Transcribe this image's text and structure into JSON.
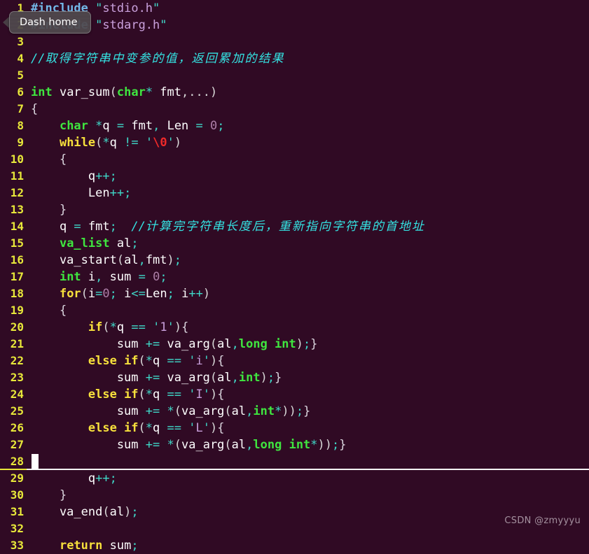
{
  "editor": {
    "background_color": "#300a24",
    "line_number_color": "#e8e83a",
    "current_line": 28,
    "cursor_line": 28,
    "lines": [
      {
        "n": "1",
        "tokens": [
          {
            "c": "t-pre",
            "t": "#include"
          },
          {
            "c": "t-plain",
            "t": " "
          },
          {
            "c": "t-quote",
            "t": "\""
          },
          {
            "c": "t-str",
            "t": "stdio.h"
          },
          {
            "c": "t-quote",
            "t": "\""
          }
        ]
      },
      {
        "n": "2",
        "tokens": [
          {
            "c": "t-pre",
            "t": "#include"
          },
          {
            "c": "t-plain",
            "t": " "
          },
          {
            "c": "t-quote",
            "t": "\""
          },
          {
            "c": "t-str",
            "t": "stdarg.h"
          },
          {
            "c": "t-quote",
            "t": "\""
          }
        ]
      },
      {
        "n": "3",
        "tokens": []
      },
      {
        "n": "4",
        "tokens": [
          {
            "c": "t-comment",
            "t": "//"
          },
          {
            "c": "t-comment t-cjk",
            "t": "取得字符串中变参的值，返回累加的结果"
          }
        ]
      },
      {
        "n": "5",
        "tokens": []
      },
      {
        "n": "6",
        "tokens": [
          {
            "c": "t-type",
            "t": "int"
          },
          {
            "c": "t-plain",
            "t": " var_sum"
          },
          {
            "c": "t-punc",
            "t": "("
          },
          {
            "c": "t-type",
            "t": "char"
          },
          {
            "c": "t-op",
            "t": "*"
          },
          {
            "c": "t-plain",
            "t": " fmt"
          },
          {
            "c": "t-punc",
            "t": ",...)"
          }
        ]
      },
      {
        "n": "7",
        "tokens": [
          {
            "c": "t-brace",
            "t": "{"
          }
        ]
      },
      {
        "n": "8",
        "tokens": [
          {
            "c": "t-plain",
            "t": "    "
          },
          {
            "c": "t-type",
            "t": "char"
          },
          {
            "c": "t-plain",
            "t": " "
          },
          {
            "c": "t-op",
            "t": "*"
          },
          {
            "c": "t-plain",
            "t": "q "
          },
          {
            "c": "t-op",
            "t": "="
          },
          {
            "c": "t-plain",
            "t": " fmt"
          },
          {
            "c": "t-op",
            "t": ","
          },
          {
            "c": "t-plain",
            "t": " Len "
          },
          {
            "c": "t-op",
            "t": "="
          },
          {
            "c": "t-plain",
            "t": " "
          },
          {
            "c": "t-num",
            "t": "0"
          },
          {
            "c": "t-op",
            "t": ";"
          }
        ]
      },
      {
        "n": "9",
        "tokens": [
          {
            "c": "t-plain",
            "t": "    "
          },
          {
            "c": "t-key",
            "t": "while"
          },
          {
            "c": "t-punc",
            "t": "("
          },
          {
            "c": "t-op",
            "t": "*"
          },
          {
            "c": "t-plain",
            "t": "q "
          },
          {
            "c": "t-op",
            "t": "!="
          },
          {
            "c": "t-plain",
            "t": " "
          },
          {
            "c": "t-quote",
            "t": "'"
          },
          {
            "c": "t-esc",
            "t": "\\0"
          },
          {
            "c": "t-quote",
            "t": "'"
          },
          {
            "c": "t-punc",
            "t": ")"
          }
        ]
      },
      {
        "n": "10",
        "tokens": [
          {
            "c": "t-plain",
            "t": "    "
          },
          {
            "c": "t-brace",
            "t": "{"
          }
        ]
      },
      {
        "n": "11",
        "tokens": [
          {
            "c": "t-plain",
            "t": "        q"
          },
          {
            "c": "t-op",
            "t": "++;"
          }
        ]
      },
      {
        "n": "12",
        "tokens": [
          {
            "c": "t-plain",
            "t": "        Len"
          },
          {
            "c": "t-op",
            "t": "++;"
          }
        ]
      },
      {
        "n": "13",
        "tokens": [
          {
            "c": "t-plain",
            "t": "    "
          },
          {
            "c": "t-brace",
            "t": "}"
          }
        ]
      },
      {
        "n": "14",
        "tokens": [
          {
            "c": "t-plain",
            "t": "    q "
          },
          {
            "c": "t-op",
            "t": "="
          },
          {
            "c": "t-plain",
            "t": " fmt"
          },
          {
            "c": "t-op",
            "t": ";"
          },
          {
            "c": "t-plain",
            "t": "  "
          },
          {
            "c": "t-comment",
            "t": "//"
          },
          {
            "c": "t-comment t-cjk",
            "t": "计算完字符串长度后，重新指向字符串的首地址"
          }
        ]
      },
      {
        "n": "15",
        "tokens": [
          {
            "c": "t-plain",
            "t": "    "
          },
          {
            "c": "t-type",
            "t": "va_list"
          },
          {
            "c": "t-plain",
            "t": " al"
          },
          {
            "c": "t-op",
            "t": ";"
          }
        ]
      },
      {
        "n": "16",
        "tokens": [
          {
            "c": "t-plain",
            "t": "    va_start"
          },
          {
            "c": "t-punc",
            "t": "("
          },
          {
            "c": "t-plain",
            "t": "al"
          },
          {
            "c": "t-op",
            "t": ","
          },
          {
            "c": "t-plain",
            "t": "fmt"
          },
          {
            "c": "t-punc",
            "t": ")"
          },
          {
            "c": "t-op",
            "t": ";"
          }
        ]
      },
      {
        "n": "17",
        "tokens": [
          {
            "c": "t-plain",
            "t": "    "
          },
          {
            "c": "t-type",
            "t": "int"
          },
          {
            "c": "t-plain",
            "t": " i"
          },
          {
            "c": "t-op",
            "t": ","
          },
          {
            "c": "t-plain",
            "t": " sum "
          },
          {
            "c": "t-op",
            "t": "="
          },
          {
            "c": "t-plain",
            "t": " "
          },
          {
            "c": "t-num",
            "t": "0"
          },
          {
            "c": "t-op",
            "t": ";"
          }
        ]
      },
      {
        "n": "18",
        "tokens": [
          {
            "c": "t-plain",
            "t": "    "
          },
          {
            "c": "t-key",
            "t": "for"
          },
          {
            "c": "t-punc",
            "t": "("
          },
          {
            "c": "t-plain",
            "t": "i"
          },
          {
            "c": "t-op",
            "t": "="
          },
          {
            "c": "t-num",
            "t": "0"
          },
          {
            "c": "t-op",
            "t": ";"
          },
          {
            "c": "t-plain",
            "t": " i"
          },
          {
            "c": "t-op",
            "t": "<="
          },
          {
            "c": "t-plain",
            "t": "Len"
          },
          {
            "c": "t-op",
            "t": ";"
          },
          {
            "c": "t-plain",
            "t": " i"
          },
          {
            "c": "t-op",
            "t": "++"
          },
          {
            "c": "t-punc",
            "t": ")"
          }
        ]
      },
      {
        "n": "19",
        "tokens": [
          {
            "c": "t-plain",
            "t": "    "
          },
          {
            "c": "t-brace",
            "t": "{"
          }
        ]
      },
      {
        "n": "20",
        "tokens": [
          {
            "c": "t-plain",
            "t": "        "
          },
          {
            "c": "t-key",
            "t": "if"
          },
          {
            "c": "t-punc",
            "t": "("
          },
          {
            "c": "t-op",
            "t": "*"
          },
          {
            "c": "t-plain",
            "t": "q "
          },
          {
            "c": "t-op",
            "t": "=="
          },
          {
            "c": "t-plain",
            "t": " "
          },
          {
            "c": "t-quote",
            "t": "'"
          },
          {
            "c": "t-char",
            "t": "1"
          },
          {
            "c": "t-quote",
            "t": "'"
          },
          {
            "c": "t-punc",
            "t": ")"
          },
          {
            "c": "t-brace",
            "t": "{"
          }
        ]
      },
      {
        "n": "21",
        "tokens": [
          {
            "c": "t-plain",
            "t": "            sum "
          },
          {
            "c": "t-op",
            "t": "+="
          },
          {
            "c": "t-plain",
            "t": " va_arg"
          },
          {
            "c": "t-punc",
            "t": "("
          },
          {
            "c": "t-plain",
            "t": "al"
          },
          {
            "c": "t-op",
            "t": ","
          },
          {
            "c": "t-type",
            "t": "long int"
          },
          {
            "c": "t-punc",
            "t": ")"
          },
          {
            "c": "t-op",
            "t": ";"
          },
          {
            "c": "t-brace",
            "t": "}"
          }
        ]
      },
      {
        "n": "22",
        "tokens": [
          {
            "c": "t-plain",
            "t": "        "
          },
          {
            "c": "t-key",
            "t": "else if"
          },
          {
            "c": "t-punc",
            "t": "("
          },
          {
            "c": "t-op",
            "t": "*"
          },
          {
            "c": "t-plain",
            "t": "q "
          },
          {
            "c": "t-op",
            "t": "=="
          },
          {
            "c": "t-plain",
            "t": " "
          },
          {
            "c": "t-quote",
            "t": "'"
          },
          {
            "c": "t-char",
            "t": "i"
          },
          {
            "c": "t-quote",
            "t": "'"
          },
          {
            "c": "t-punc",
            "t": ")"
          },
          {
            "c": "t-brace",
            "t": "{"
          }
        ]
      },
      {
        "n": "23",
        "tokens": [
          {
            "c": "t-plain",
            "t": "            sum "
          },
          {
            "c": "t-op",
            "t": "+="
          },
          {
            "c": "t-plain",
            "t": " va_arg"
          },
          {
            "c": "t-punc",
            "t": "("
          },
          {
            "c": "t-plain",
            "t": "al"
          },
          {
            "c": "t-op",
            "t": ","
          },
          {
            "c": "t-type",
            "t": "int"
          },
          {
            "c": "t-punc",
            "t": ")"
          },
          {
            "c": "t-op",
            "t": ";"
          },
          {
            "c": "t-brace",
            "t": "}"
          }
        ]
      },
      {
        "n": "24",
        "tokens": [
          {
            "c": "t-plain",
            "t": "        "
          },
          {
            "c": "t-key",
            "t": "else if"
          },
          {
            "c": "t-punc",
            "t": "("
          },
          {
            "c": "t-op",
            "t": "*"
          },
          {
            "c": "t-plain",
            "t": "q "
          },
          {
            "c": "t-op",
            "t": "=="
          },
          {
            "c": "t-plain",
            "t": " "
          },
          {
            "c": "t-quote",
            "t": "'"
          },
          {
            "c": "t-char",
            "t": "I"
          },
          {
            "c": "t-quote",
            "t": "'"
          },
          {
            "c": "t-punc",
            "t": ")"
          },
          {
            "c": "t-brace",
            "t": "{"
          }
        ]
      },
      {
        "n": "25",
        "tokens": [
          {
            "c": "t-plain",
            "t": "            sum "
          },
          {
            "c": "t-op",
            "t": "+="
          },
          {
            "c": "t-plain",
            "t": " "
          },
          {
            "c": "t-op",
            "t": "*"
          },
          {
            "c": "t-punc",
            "t": "("
          },
          {
            "c": "t-plain",
            "t": "va_arg"
          },
          {
            "c": "t-punc",
            "t": "("
          },
          {
            "c": "t-plain",
            "t": "al"
          },
          {
            "c": "t-op",
            "t": ","
          },
          {
            "c": "t-type",
            "t": "int"
          },
          {
            "c": "t-op",
            "t": "*"
          },
          {
            "c": "t-punc",
            "t": "))"
          },
          {
            "c": "t-op",
            "t": ";"
          },
          {
            "c": "t-brace",
            "t": "}"
          }
        ]
      },
      {
        "n": "26",
        "tokens": [
          {
            "c": "t-plain",
            "t": "        "
          },
          {
            "c": "t-key",
            "t": "else if"
          },
          {
            "c": "t-punc",
            "t": "("
          },
          {
            "c": "t-op",
            "t": "*"
          },
          {
            "c": "t-plain",
            "t": "q "
          },
          {
            "c": "t-op",
            "t": "=="
          },
          {
            "c": "t-plain",
            "t": " "
          },
          {
            "c": "t-quote",
            "t": "'"
          },
          {
            "c": "t-char",
            "t": "L"
          },
          {
            "c": "t-quote",
            "t": "'"
          },
          {
            "c": "t-punc",
            "t": ")"
          },
          {
            "c": "t-brace",
            "t": "{"
          }
        ]
      },
      {
        "n": "27",
        "tokens": [
          {
            "c": "t-plain",
            "t": "            sum "
          },
          {
            "c": "t-op",
            "t": "+="
          },
          {
            "c": "t-plain",
            "t": " "
          },
          {
            "c": "t-op",
            "t": "*"
          },
          {
            "c": "t-punc",
            "t": "("
          },
          {
            "c": "t-plain",
            "t": "va_arg"
          },
          {
            "c": "t-punc",
            "t": "("
          },
          {
            "c": "t-plain",
            "t": "al"
          },
          {
            "c": "t-op",
            "t": ","
          },
          {
            "c": "t-type",
            "t": "long int"
          },
          {
            "c": "t-op",
            "t": "*"
          },
          {
            "c": "t-punc",
            "t": "))"
          },
          {
            "c": "t-op",
            "t": ";"
          },
          {
            "c": "t-brace",
            "t": "}"
          }
        ]
      },
      {
        "n": "28",
        "tokens": [],
        "current": true
      },
      {
        "n": "29",
        "tokens": [
          {
            "c": "t-plain",
            "t": "        q"
          },
          {
            "c": "t-op",
            "t": "++;"
          }
        ]
      },
      {
        "n": "30",
        "tokens": [
          {
            "c": "t-plain",
            "t": "    "
          },
          {
            "c": "t-brace",
            "t": "}"
          }
        ]
      },
      {
        "n": "31",
        "tokens": [
          {
            "c": "t-plain",
            "t": "    va_end"
          },
          {
            "c": "t-punc",
            "t": "("
          },
          {
            "c": "t-plain",
            "t": "al"
          },
          {
            "c": "t-punc",
            "t": ")"
          },
          {
            "c": "t-op",
            "t": ";"
          }
        ]
      },
      {
        "n": "32",
        "tokens": []
      },
      {
        "n": "33",
        "tokens": [
          {
            "c": "t-plain",
            "t": "    "
          },
          {
            "c": "t-key",
            "t": "return"
          },
          {
            "c": "t-plain",
            "t": " sum"
          },
          {
            "c": "t-op",
            "t": ";"
          }
        ]
      }
    ]
  },
  "dash_tooltip": {
    "label": "Dash home"
  },
  "watermark": {
    "text": "CSDN @zmyyyu"
  }
}
